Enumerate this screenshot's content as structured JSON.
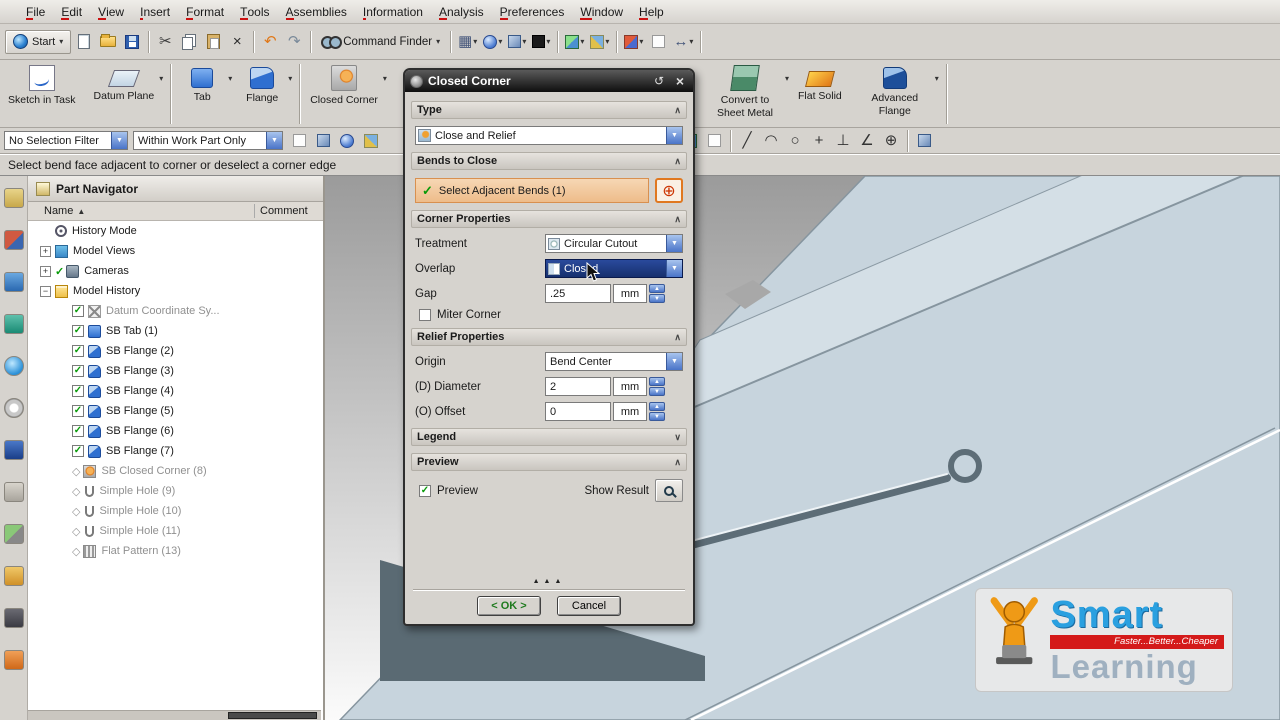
{
  "menu_bar": {
    "items": [
      "File",
      "Edit",
      "View",
      "Insert",
      "Format",
      "Tools",
      "Assemblies",
      "Information",
      "Analysis",
      "Preferences",
      "Window",
      "Help"
    ]
  },
  "toolbar_main": {
    "start_label": "Start",
    "command_finder_label": "Command Finder",
    "items": [
      {
        "name": "new-file",
        "shape": "page"
      },
      {
        "name": "open-file",
        "shape": "folder"
      },
      {
        "name": "save",
        "shape": "disk"
      },
      {
        "sep": true
      },
      {
        "name": "cut",
        "glyph": "✂",
        "color": "#3a3a3a"
      },
      {
        "name": "copy",
        "shape": "copy"
      },
      {
        "name": "paste",
        "shape": "paste"
      },
      {
        "name": "delete",
        "glyph": "×",
        "color": "#2a2a2a"
      },
      {
        "sep": true
      },
      {
        "name": "undo",
        "glyph": "↶",
        "color": "#e07818"
      },
      {
        "name": "redo",
        "glyph": "↷",
        "color": "#7a8a9a"
      },
      {
        "sep": true
      }
    ],
    "items2": [
      {
        "sep": true
      },
      {
        "name": "window-layout",
        "glyph": "▦",
        "color": "#44557a",
        "arrow": true
      },
      {
        "name": "display-sphere",
        "shape": "sphere",
        "arrow": true
      },
      {
        "name": "display-cube",
        "shape": "cube",
        "arrow": true
      },
      {
        "name": "background-color",
        "shape": "blacksq",
        "arrow": true
      },
      {
        "sep": true
      },
      {
        "name": "rendering-style",
        "shape": "cubecolor",
        "arrow": true
      },
      {
        "name": "view-orientation",
        "shape": "cubecolor2",
        "arrow": true
      },
      {
        "sep": true
      },
      {
        "name": "section-view",
        "shape": "redblue",
        "arrow": true
      },
      {
        "name": "show-hide",
        "shape": "whitebox"
      },
      {
        "name": "measure",
        "glyph": "↔",
        "color": "#44557a",
        "arrow": true
      },
      {
        "sep": true
      }
    ]
  },
  "ribbon": {
    "groups": [
      {
        "label": "Sketch in Task",
        "icon": "sketch-in-task",
        "side": "left"
      },
      {
        "label": "Datum Plane",
        "icon": "datum-plane",
        "side": "left",
        "arrow": true,
        "sep_after": true
      },
      {
        "label": "Tab",
        "icon": "tab",
        "side": "left",
        "arrow": true
      },
      {
        "label": "Flange",
        "icon": "flange",
        "side": "left",
        "arrow": true,
        "sep_after": true
      },
      {
        "label": "Closed Corner",
        "icon": "closed-corner",
        "side": "left",
        "arrow": true
      },
      {
        "label": "Convert to Sheet Metal",
        "icon": "convert-to-sheet-metal",
        "side": "right",
        "arrow": true
      },
      {
        "label": "Flat Solid",
        "icon": "flat-solid",
        "side": "right"
      },
      {
        "label": "Advanced Flange",
        "icon": "advanced-flange",
        "side": "right",
        "arrow": true,
        "sep_after": true
      }
    ]
  },
  "selection_bar": {
    "filter_value": "No Selection Filter",
    "scope_value": "Within Work Part Only",
    "icons_left": [
      {
        "name": "general-selection",
        "shape": "whitebox"
      },
      {
        "name": "select-rectangle",
        "shape": "cube"
      },
      {
        "name": "snap-point",
        "shape": "sphere"
      },
      {
        "name": "selection-preview",
        "shape": "cubecolor2"
      }
    ],
    "icons_right": [
      {
        "name": "filter-face",
        "shape": "cubecolor"
      },
      {
        "name": "datum-display",
        "shape": "whitebox"
      },
      {
        "sep": true
      },
      {
        "name": "sketch-line",
        "glyph": "╱",
        "color": "#333"
      },
      {
        "name": "sketch-arc",
        "glyph": "◠",
        "color": "#333"
      },
      {
        "name": "sketch-circle",
        "glyph": "○",
        "color": "#333"
      },
      {
        "name": "sketch-point",
        "glyph": "+",
        "color": "#333"
      },
      {
        "name": "perpendicular",
        "glyph": "⊥",
        "color": "#333"
      },
      {
        "name": "angle-dimension",
        "glyph": "∠",
        "color": "#333"
      },
      {
        "name": "target-point",
        "glyph": "⊕",
        "color": "#333"
      },
      {
        "sep": true
      },
      {
        "name": "work-view",
        "shape": "cube"
      }
    ]
  },
  "prompt_bar": {
    "text": "Select bend face adjacent to corner or deselect a corner edge"
  },
  "left_toolbar": {
    "items": [
      "assembly-navigator",
      "constraint-navigator",
      "part-navigator",
      "reuse-library",
      "hd3d-tools",
      "web-browser",
      "history",
      "process-studio",
      "manufacturing-wizards",
      "roles",
      "system-scenes",
      "touch-mode"
    ]
  },
  "part_navigator": {
    "title": "Part Navigator",
    "name_column": "Name",
    "comment_column": "Comment",
    "items": [
      {
        "label": "History Mode",
        "icon": "history",
        "indent": 1
      },
      {
        "label": "Model Views",
        "icon": "model-views",
        "indent": 1,
        "expand": "plus"
      },
      {
        "label": "Cameras",
        "icon": "cameras",
        "indent": 1,
        "expand": "plus",
        "check": true
      },
      {
        "label": "Model History",
        "icon": "folder",
        "indent": 1,
        "expand": "minus"
      },
      {
        "label": "Datum Coordinate Sy...",
        "icon": "datum-cs",
        "indent": 2,
        "checkbox": true,
        "gray": true
      },
      {
        "label": "SB Tab (1)",
        "icon": "tab",
        "indent": 2,
        "checkbox": true
      },
      {
        "label": "SB Flange (2)",
        "icon": "flange",
        "indent": 2,
        "checkbox": true
      },
      {
        "label": "SB Flange (3)",
        "icon": "flange",
        "indent": 2,
        "checkbox": true
      },
      {
        "label": "SB Flange (4)",
        "icon": "flange",
        "indent": 2,
        "checkbox": true
      },
      {
        "label": "SB Flange (5)",
        "icon": "flange",
        "indent": 2,
        "checkbox": true
      },
      {
        "label": "SB Flange (6)",
        "icon": "flange",
        "indent": 2,
        "checkbox": true
      },
      {
        "label": "SB Flange (7)",
        "icon": "flange",
        "indent": 2,
        "checkbox": true
      },
      {
        "label": "SB Closed Corner (8)",
        "icon": "closed-corner",
        "indent": 2,
        "suppressed": true,
        "gray": true
      },
      {
        "label": "Simple Hole (9)",
        "icon": "hole",
        "indent": 2,
        "suppressed": true,
        "gray": true
      },
      {
        "label": "Simple Hole (10)",
        "icon": "hole",
        "indent": 2,
        "suppressed": true,
        "gray": true
      },
      {
        "label": "Simple Hole (11)",
        "icon": "hole",
        "indent": 2,
        "suppressed": true,
        "gray": true
      },
      {
        "label": "Flat Pattern (13)",
        "icon": "flat-pattern",
        "indent": 2,
        "suppressed": true,
        "gray": true
      }
    ]
  },
  "dialog": {
    "title": "Closed Corner",
    "type": {
      "header": "Type",
      "value": "Close and Relief"
    },
    "bends": {
      "header": "Bends to Close",
      "select_label": "Select Adjacent Bends (1)"
    },
    "corner": {
      "header": "Corner Properties",
      "treatment_label": "Treatment",
      "treatment_value": "Circular Cutout",
      "overlap_label": "Overlap",
      "overlap_value": "Closed",
      "gap_label": "Gap",
      "gap_value": ".25",
      "gap_unit": "mm",
      "miter_label": "Miter Corner"
    },
    "relief": {
      "header": "Relief Properties",
      "origin_label": "Origin",
      "origin_value": "Bend Center",
      "diameter_label": "(D) Diameter",
      "diameter_value": "2",
      "diameter_unit": "mm",
      "offset_label": "(O) Offset",
      "offset_value": "0",
      "offset_unit": "mm"
    },
    "legend_header": "Legend",
    "preview": {
      "header": "Preview",
      "preview_label": "Preview",
      "show_result_label": "Show Result"
    },
    "ok_label": "< OK >",
    "cancel_label": "Cancel"
  },
  "logo": {
    "brand_top": "Smart",
    "brand_bottom": "Learning",
    "tagline": "Faster...Better...Cheaper"
  },
  "colors": {
    "accent_orange": "#e07818",
    "selection_blue": "#16306e",
    "ok_green": "#1e7a1e",
    "highlight_fill": "#f2c9a0",
    "part_blue": "#c7d4dd"
  }
}
